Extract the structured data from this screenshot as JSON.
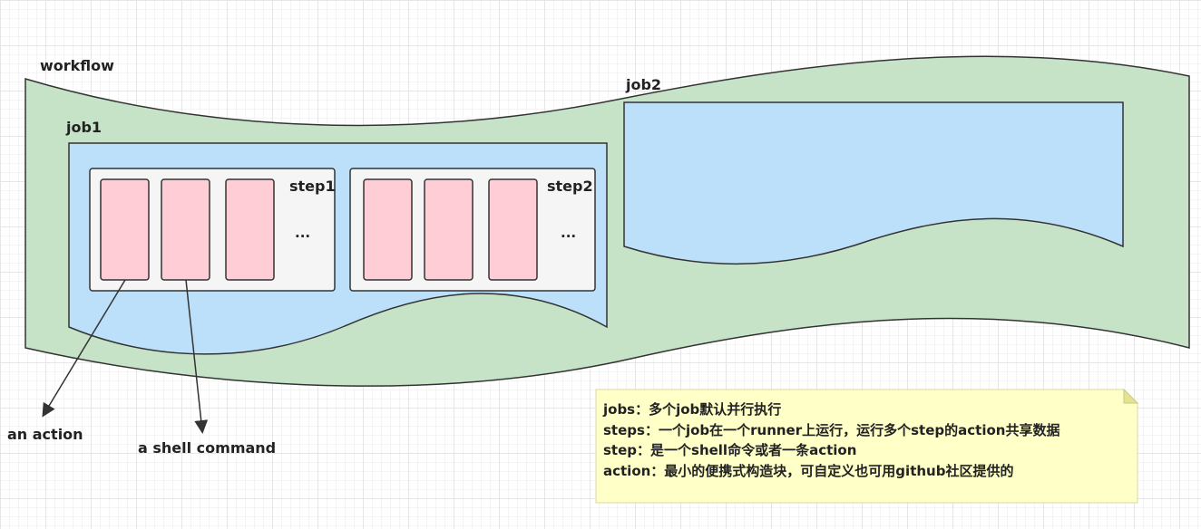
{
  "labels": {
    "workflow": "workflow",
    "job1": "job1",
    "job2": "job2",
    "step1": "step1",
    "step2": "step2",
    "step1_more": "...",
    "step2_more": "...",
    "an_action": "an action",
    "a_shell_command": "a shell command"
  },
  "note": {
    "lines": [
      "jobs：多个job默认并行执行",
      "steps：一个job在一个runner上运行，运行多个step的action共享数据",
      "step：是一个shell命令或者一条action",
      "action：最小的便携式构造块，可自定义也可用github社区提供的"
    ]
  },
  "colors": {
    "workflow_fill": "#c6e3c7",
    "job_fill": "#bde0fa",
    "step_fill": "#f5f5f5",
    "item_fill": "#ffcdd5",
    "note_fill": "#ffffc8",
    "stroke": "#333333"
  }
}
